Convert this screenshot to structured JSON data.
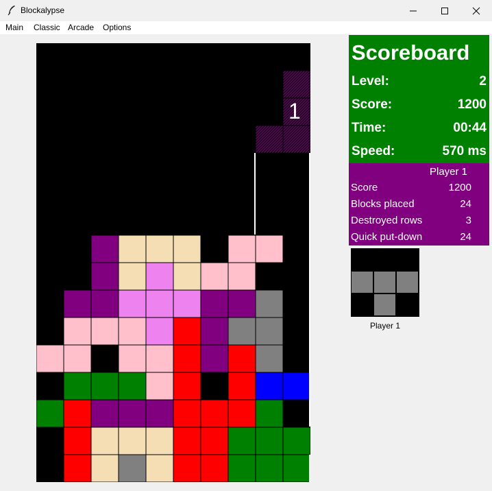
{
  "window": {
    "title": "Blockalypse",
    "minimize_icon": "minimize-icon",
    "maximize_icon": "maximize-icon",
    "close_icon": "close-icon"
  },
  "menu": {
    "items": [
      "Main",
      "Classic",
      "Arcade",
      "Options"
    ]
  },
  "board": {
    "columns": 10,
    "rows": 16,
    "grid": [
      "..........",
      "..........",
      "..........",
      "..........",
      "..........",
      "..........",
      "..........",
      "..........",
      "..PBBB.PP.",
      "..PBVBPP..",
      ".PPVVVPPG.",
      ".PPPVRPGG.",
      "PP.PPRPRG.",
      ".GGGPR.RUU",
      "GRPPPRRRG.",
      ".RBBBRRGGG",
      ".RBGBRRGGG"
    ],
    "colors": {
      "P": "#ffc0cb",
      "B": "#f5deb3",
      "V": "#ee82ee",
      "M": "#800080",
      "R": "#ff0000",
      "G": "#008000",
      "U": "#0000ff",
      "Y": "#808080"
    },
    "falling_piece_color": "#4b0f4b",
    "falling_piece_label": "1",
    "guide_color": "#ffffff"
  },
  "scoreboard": {
    "title": "Scoreboard",
    "level_label": "Level:",
    "level_value": "2",
    "score_label": "Score:",
    "score_value": "1200",
    "time_label": "Time:",
    "time_value": "00:44",
    "speed_label": "Speed:",
    "speed_value": "570 ms",
    "background": "#008000"
  },
  "player": {
    "heading": "Player 1",
    "score_label": "Score",
    "score_value": "1200",
    "blocks_label": "Blocks placed",
    "blocks_value": "24",
    "rows_label": "Destroyed rows",
    "rows_value": "3",
    "quick_label": "Quick put-down",
    "quick_value": "24",
    "background": "#800080"
  },
  "next_piece": {
    "label": "Player 1",
    "color": "#808080"
  }
}
